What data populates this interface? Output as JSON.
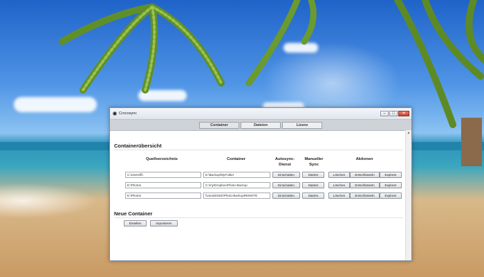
{
  "window": {
    "title": "Crocosync",
    "controls": {
      "minimize": "–",
      "maximize": "□",
      "close": "✕"
    }
  },
  "tabs": [
    {
      "label": "Container",
      "active": true
    },
    {
      "label": "Dateien",
      "active": false
    },
    {
      "label": "Lizenz",
      "active": false
    }
  ],
  "containers_section": {
    "title": "Containerübersicht",
    "headers": {
      "source": "Quellverzeichnis",
      "container": "Container",
      "autosync_1": "Autosync-",
      "autosync_2": "Dienst",
      "manual_1": "Manueller",
      "manual_2": "Sync",
      "actions": "Aktionen"
    },
    "rows": [
      {
        "source": "C:\\Users\\fh",
        "container": "E:\\Backup\\MyFolder",
        "autosync": "Einschalten",
        "sync": "Starten",
        "delete": "Löschen",
        "decrypt": "Entschlüsseln",
        "explorer": "Explorer"
      },
      {
        "source": "E:\\Photos",
        "container": "C:\\my\\Dropbox\\Photo-Backup",
        "autosync": "Einschalten",
        "sync": "Starten",
        "delete": "Löschen",
        "decrypt": "Entschlüsseln",
        "explorer": "Explorer"
      },
      {
        "source": "E:\\Photos",
        "container": "\\\\vanda\\stick\\Photo-BackupREMOTE",
        "autosync": "Einschalten",
        "sync": "Starten",
        "delete": "Löschen",
        "decrypt": "Entschlüsseln",
        "explorer": "Explorer"
      }
    ]
  },
  "new_container_section": {
    "title": "Neue Container",
    "create_label": "Erstellen",
    "import_label": "Importieren"
  },
  "colors": {
    "tab_strip": "#cfd2d6",
    "close_button": "#c7412b"
  }
}
